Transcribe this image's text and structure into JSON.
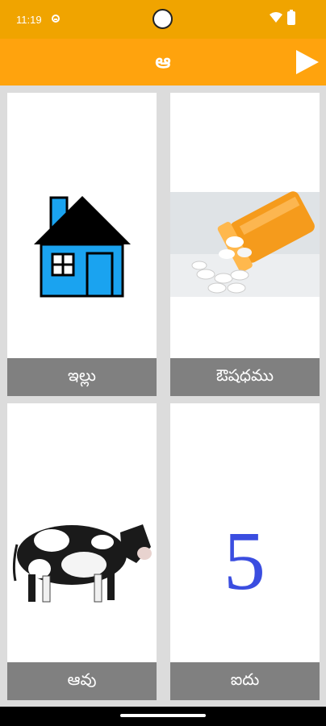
{
  "status_bar": {
    "time": "11:19",
    "icons": [
      "notification-icon",
      "camera-cutout",
      "wifi-icon",
      "battery-icon"
    ]
  },
  "app_bar": {
    "title": "ఆ",
    "play_icon": "play-icon",
    "background_color": "#ffa30d"
  },
  "cards": [
    {
      "label": "ఇల్లు",
      "icon": "house-icon"
    },
    {
      "label": "ఔషధము",
      "icon": "medicine-pills-icon"
    },
    {
      "label": "ఆవు",
      "icon": "cow-icon"
    },
    {
      "label": "ఐదు",
      "icon": "number-five-icon",
      "glyph": "5"
    }
  ],
  "colors": {
    "status_bar": "#f0a400",
    "label_background": "#808080",
    "grid_background": "#dcdcdc"
  }
}
